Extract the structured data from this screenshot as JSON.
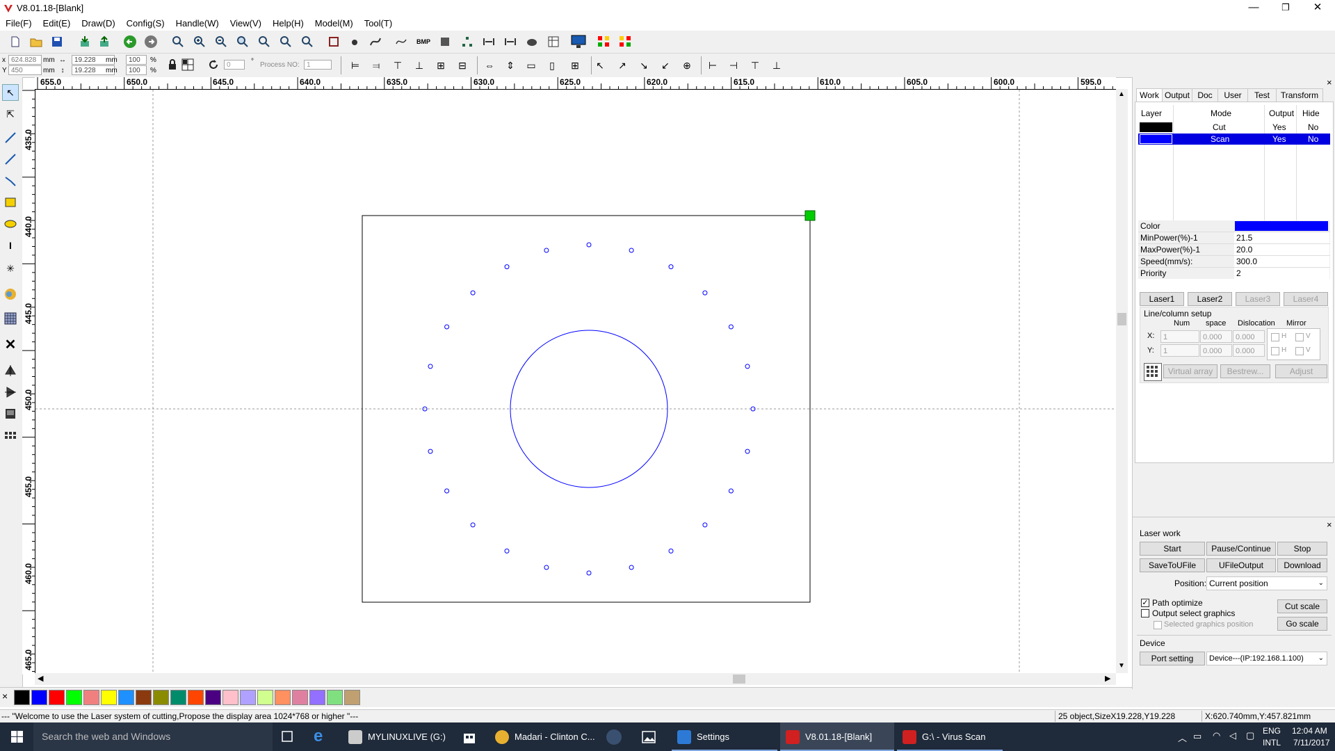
{
  "window": {
    "title": "V8.01.18-[Blank]",
    "controls": {
      "minimize": "—",
      "maximize": "❐",
      "close": "✕"
    }
  },
  "menu": [
    "File(F)",
    "Edit(E)",
    "Draw(D)",
    "Config(S)",
    "Handle(W)",
    "View(V)",
    "Help(H)",
    "Model(M)",
    "Tool(T)"
  ],
  "coords": {
    "x_label": "x",
    "y_label": "Y",
    "x_value": "624.828",
    "y_value": "450",
    "x_unit": "mm",
    "y_unit": "mm",
    "width_value": "19.228",
    "height_value": "19.228",
    "w_unit": "mm",
    "h_unit": "mm",
    "scale_x": "100",
    "scale_y": "100",
    "pct": "%",
    "rotate_value": "0",
    "degree": "°",
    "process_no_label": "Process NO:",
    "process_no_value": "1"
  },
  "ruler": {
    "top": [
      "655.0",
      "650.0",
      "645.0",
      "640.0",
      "635.0",
      "630.0",
      "625.0",
      "620.0",
      "615.0",
      "610.0",
      "605.0",
      "600.0",
      "595.0"
    ],
    "left": [
      "435.0",
      "440.0",
      "445.0",
      "450.0",
      "455.0",
      "460.0",
      "465.0"
    ]
  },
  "palette": {
    "close": "×",
    "colors": [
      "#000000",
      "#0000ff",
      "#ff0000",
      "#00ff00",
      "#f08080",
      "#ffff00",
      "#1e90ff",
      "#8b3a0f",
      "#8b8b00",
      "#008b6b",
      "#ff4500",
      "#4b0082",
      "#ffc0cb",
      "#b0a0ff",
      "#d0ff90",
      "#ff9060",
      "#e080a0",
      "#9370ff",
      "#80e080",
      "#c0a070"
    ]
  },
  "status": {
    "message": "--- \"Welcome to use the Laser system of cutting,Propose the display area 1024*768 or higher \"---",
    "objects": "25 object,SizeX19.228,Y19.228",
    "position": "X:620.740mm,Y:457.821mm"
  },
  "panel": {
    "tabs": [
      "Work",
      "Output",
      "Doc",
      "User",
      "Test",
      "Transform"
    ],
    "layer_headers": {
      "layer": "Layer",
      "mode": "Mode",
      "output": "Output",
      "hide": "Hide"
    },
    "layers": [
      {
        "color": "#000000",
        "mode": "Cut",
        "output": "Yes",
        "hide": "No",
        "selected": false
      },
      {
        "color": "#0000ff",
        "mode": "Scan",
        "output": "Yes",
        "hide": "No",
        "selected": true
      }
    ],
    "props": [
      {
        "label": "Color",
        "value": ""
      },
      {
        "label": "MinPower(%)-1",
        "value": "21.5"
      },
      {
        "label": "MaxPower(%)-1",
        "value": "20.0"
      },
      {
        "label": "Speed(mm/s):",
        "value": "300.0"
      },
      {
        "label": "Priority",
        "value": "2"
      }
    ],
    "prop_color": "#0000ff",
    "lasers": [
      "Laser1",
      "Laser2",
      "Laser3",
      "Laser4"
    ],
    "array": {
      "title": "Line/column setup",
      "headers": [
        "Num",
        "space",
        "Dislocation",
        "Mirror"
      ],
      "x_label": "X:",
      "y_label": "Y:",
      "x": {
        "num": "1",
        "space": "0.000",
        "dis": "0.000"
      },
      "y": {
        "num": "1",
        "space": "0.000",
        "dis": "0.000"
      },
      "h": "H",
      "v": "V",
      "buttons": [
        "Virtual array",
        "Bestrew...",
        "Adjust"
      ]
    },
    "laserwork": {
      "title": "Laser work",
      "buttons": [
        "Start",
        "Pause/Continue",
        "Stop",
        "SaveToUFile",
        "UFileOutput",
        "Download"
      ],
      "position_label": "Position:",
      "position_value": "Current position",
      "path_optimize": "Path optimize",
      "output_select": "Output select graphics",
      "selected_pos": "Selected graphics position",
      "cut_scale": "Cut scale",
      "go_scale": "Go scale",
      "check_mark": "✓"
    },
    "device": {
      "title": "Device",
      "port_setting": "Port setting",
      "device_value": "Device---(IP:192.168.1.100)"
    },
    "close": "×"
  },
  "taskbar": {
    "search_placeholder": "Search the web and Windows",
    "apps": [
      {
        "label": "MYLINUXLIVE (G:)",
        "color": "#e0e0e0"
      },
      {
        "label": "Madari - Clinton C...",
        "color": "#e8b030"
      },
      {
        "label": "Settings",
        "color": "#2d7ad6"
      },
      {
        "label": "V8.01.18-[Blank]",
        "color": "#d02020"
      },
      {
        "label": "G:\\ - Virus Scan",
        "color": "#d02020"
      }
    ],
    "lang1": "ENG",
    "lang2": "INTL",
    "time": "12:04 AM",
    "date": "7/11/2017"
  }
}
